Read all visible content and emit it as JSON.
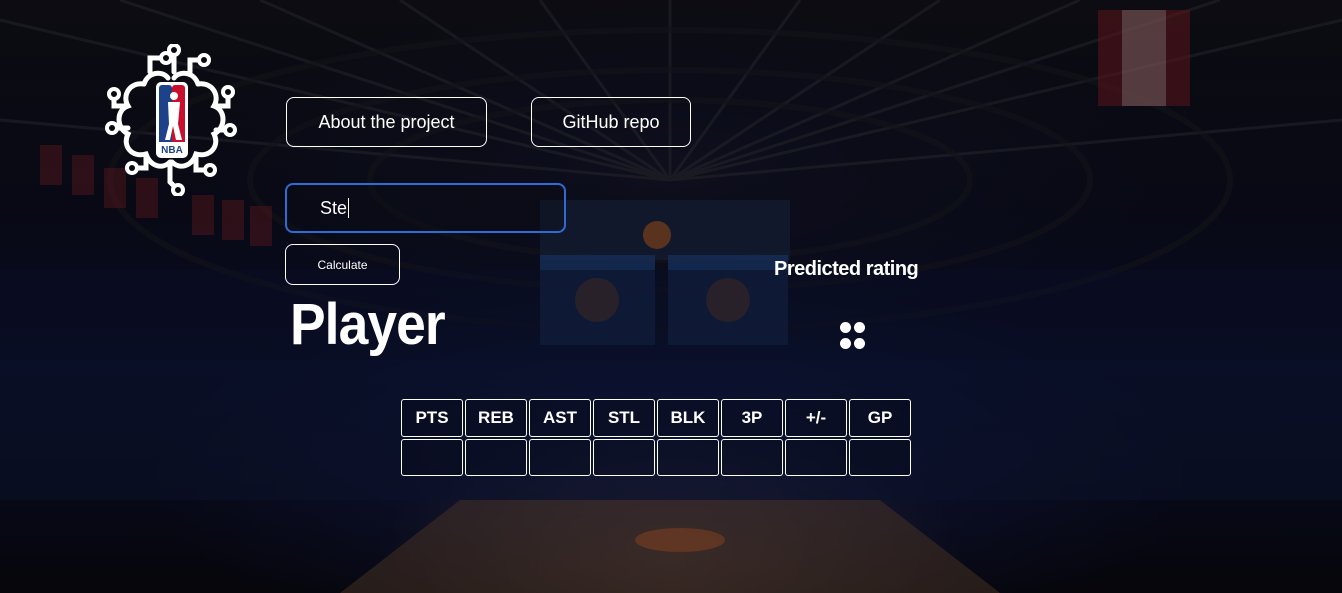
{
  "nav": {
    "about_label": "About the project",
    "github_label": "GitHub repo"
  },
  "logo": {
    "icon": "nba-circuit-brain-logo",
    "badge_text": "NBA"
  },
  "search": {
    "value": "Ste",
    "focus_color": "#2f6bd6"
  },
  "calculate_label": "Calculate",
  "player": {
    "title": "Player"
  },
  "prediction": {
    "label": "Predicted rating",
    "value_icon": "loading-dots-icon"
  },
  "stats": {
    "headers": [
      "PTS",
      "REB",
      "AST",
      "STL",
      "BLK",
      "3P",
      "+/-",
      "GP"
    ],
    "values": [
      "",
      "",
      "",
      "",
      "",
      "",
      "",
      ""
    ]
  },
  "colors": {
    "text": "#ffffff",
    "nba_blue": "#1d428a",
    "nba_red": "#c8102e"
  }
}
